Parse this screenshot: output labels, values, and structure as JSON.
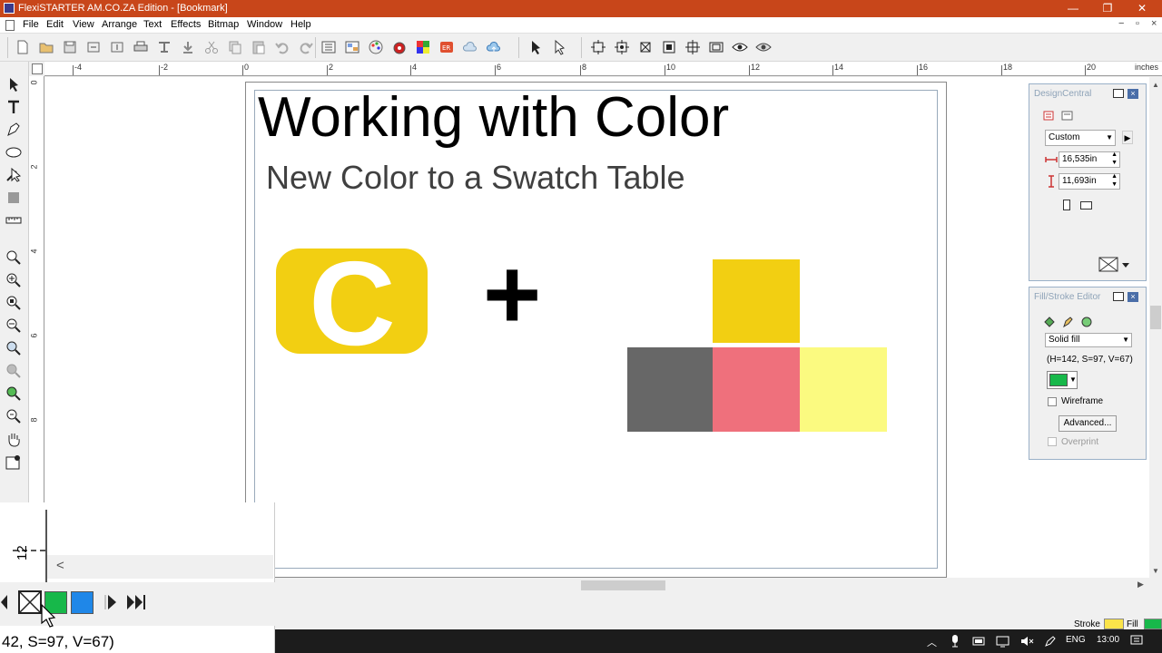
{
  "window": {
    "title": "FlexiSTARTER AM.CO.ZA Edition - [Bookmark]",
    "minimize": "—",
    "restore": "❐",
    "close": "✕"
  },
  "menu": [
    "File",
    "Edit",
    "View",
    "Arrange",
    "Text",
    "Effects",
    "Bitmap",
    "Window",
    "Help"
  ],
  "mdi_controls": {
    "minimize": "−",
    "restore": "▫",
    "close": "×"
  },
  "ruler": {
    "h_labels": [
      "-4",
      "-2",
      "0",
      "2",
      "4",
      "6",
      "8",
      "10",
      "12",
      "14",
      "16",
      "18",
      "20"
    ],
    "units": "inches",
    "v_labels": [
      "0",
      "2",
      "4",
      "6",
      "8"
    ]
  },
  "canvas": {
    "heading": "Working with Color",
    "subheading": "New Color to a Swatch Table",
    "plus": "+",
    "logo_letter": "C",
    "colors": {
      "yellow": "#f2cf12",
      "gray": "#676767",
      "pink": "#ef707c",
      "light_yellow": "#fbfa80"
    }
  },
  "design_central": {
    "title": "DesignCentral",
    "preset": "Custom",
    "width": "16,535in",
    "height": "11,693in"
  },
  "fill_stroke": {
    "title": "Fill/Stroke Editor",
    "fill_type": "Solid fill",
    "hsv": "(H=142, S=97, V=67)",
    "color": "#17b84a",
    "wireframe_label": "Wireframe",
    "advanced_label": "Advanced...",
    "overprint_label": "Overprint"
  },
  "palette": {
    "ruler_label": "12",
    "back_label": "<",
    "swatches": [
      "#17b84a",
      "#1f87e8"
    ],
    "status_text": "42, S=97, V=67)"
  },
  "statusbar": {
    "stroke_label": "Stroke",
    "fill_label": "Fill",
    "stroke_color": "#fbe44a",
    "fill_color": "#17b84a"
  },
  "taskbar": {
    "language": "ENG",
    "time": "13:00"
  }
}
